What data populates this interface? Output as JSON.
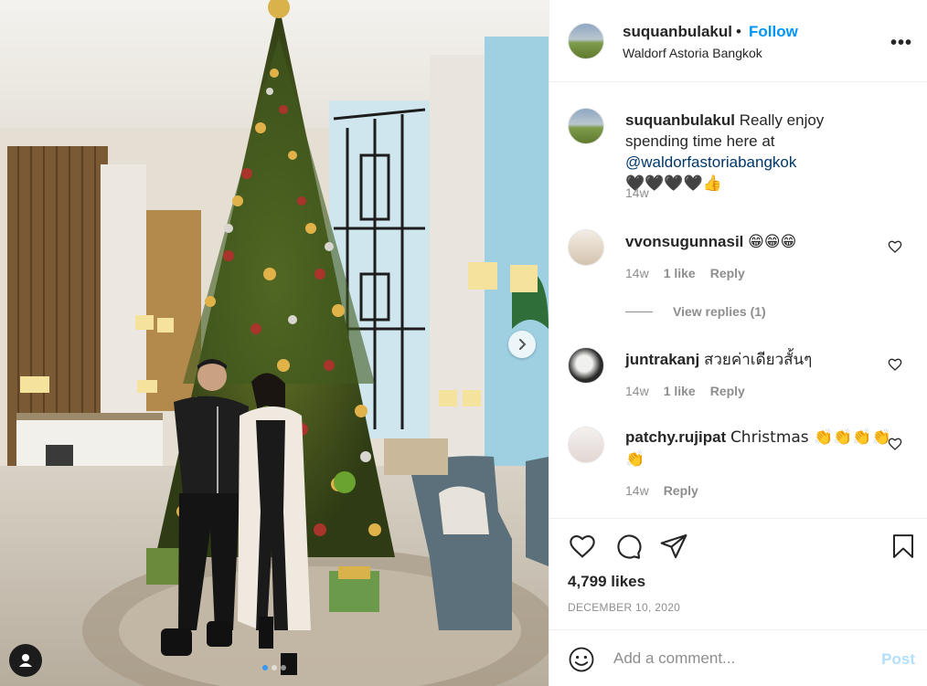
{
  "post": {
    "username": "suquanbulakul",
    "separator": "•",
    "follow_label": "Follow",
    "location": "Waldorf Astoria Bangkok",
    "more_label": "•••",
    "caption": {
      "username": "suquanbulakul",
      "text_1": "Really enjoy spending time here at",
      "mention": "@waldorfastoriabangkok",
      "emoji": "🖤🖤🖤🖤👍",
      "time": "14w"
    }
  },
  "comments": [
    {
      "username": "vvonsugunnasil",
      "text": "😁😁😁",
      "time": "14w",
      "likes": "1 like",
      "reply_label": "Reply"
    },
    {
      "username": "juntrakanj",
      "text": "สวยค่าเดียวสั้นๆ",
      "time": "14w",
      "likes": "1 like",
      "reply_label": "Reply"
    },
    {
      "username": "patchy.rujipat",
      "text": "Christmas 👏👏👏👏👏",
      "time": "14w",
      "reply_label": "Reply"
    }
  ],
  "view_replies_label": "View replies (1)",
  "likes_count": "4,799 likes",
  "date": "DECEMBER 10, 2020",
  "add_comment": {
    "placeholder": "Add a comment...",
    "post_label": "Post"
  },
  "colors": {
    "link": "#0095f6",
    "mention": "#00376b",
    "muted": "#8e8e8e",
    "post_disabled": "#b2dffc"
  }
}
